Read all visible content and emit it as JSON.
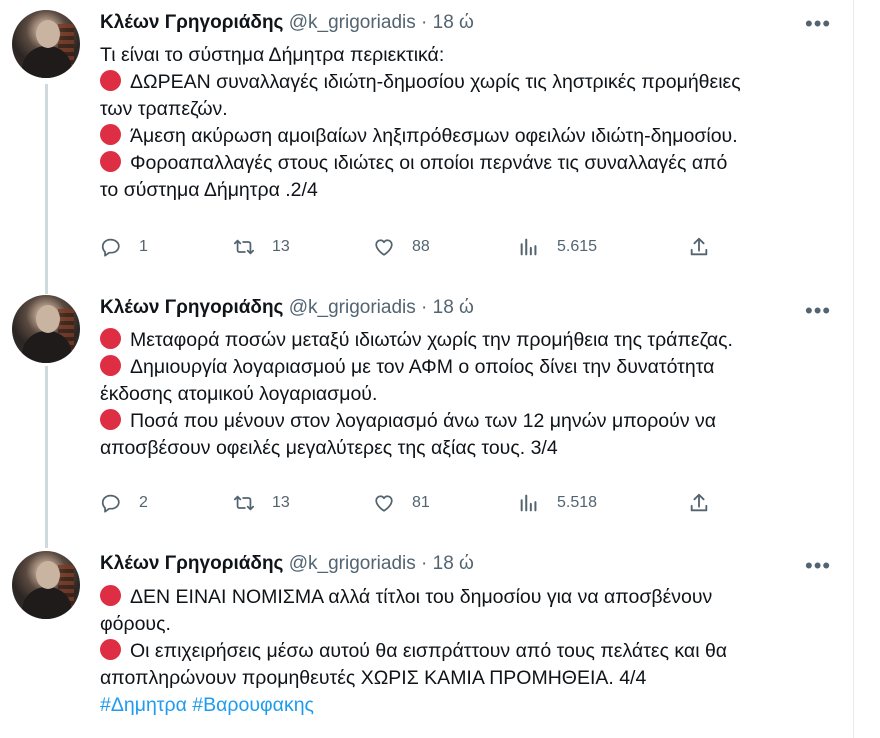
{
  "tweets": [
    {
      "author": {
        "name": "Κλέων Γρηγοριάδης",
        "handle": "@k_grigoriadis",
        "separator": "·",
        "time": "18 ώ"
      },
      "more": "•••",
      "lines": [
        {
          "dot": false,
          "text": "Τι είναι το σύστημα Δήμητρα περιεκτικά:"
        },
        {
          "dot": true,
          "text": "ΔΩΡΕΑΝ συναλλαγές ιδιώτη-δημοσίου χωρίς τις ληστρικές προμήθειες"
        },
        {
          "dot": false,
          "text": "των τραπεζών."
        },
        {
          "dot": true,
          "text": "Άμεση ακύρωση αμοιβαίων ληξιπρόθεσμων οφειλών ιδιώτη-δημοσίου."
        },
        {
          "dot": true,
          "text": "Φοροαπαλλαγές στους ιδιώτες οι οποίοι περνάνε τις συναλλαγές από"
        },
        {
          "dot": false,
          "text": "το σύστημα Δήμητρα .2/4"
        }
      ],
      "stats": {
        "replies": "1",
        "retweets": "13",
        "likes": "88",
        "views": "5.615"
      }
    },
    {
      "author": {
        "name": "Κλέων Γρηγοριάδης",
        "handle": "@k_grigoriadis",
        "separator": "·",
        "time": "18 ώ"
      },
      "more": "•••",
      "lines": [
        {
          "dot": true,
          "text": "Μεταφορά ποσών μεταξύ ιδιωτών χωρίς την προμήθεια της τράπεζας."
        },
        {
          "dot": true,
          "text": "Δημιουργία λογαριασμού με τον ΑΦΜ ο οποίος δίνει την δυνατότητα"
        },
        {
          "dot": false,
          "text": "έκδοσης ατομικού λογαριασμού."
        },
        {
          "dot": true,
          "text": "Ποσά που μένουν στον λογαριασμό άνω των 12 μηνών μπορούν να"
        },
        {
          "dot": false,
          "text": "αποσβέσουν οφειλές μεγαλύτερες της αξίας τους. 3/4"
        }
      ],
      "stats": {
        "replies": "2",
        "retweets": "13",
        "likes": "81",
        "views": "5.518"
      }
    },
    {
      "author": {
        "name": "Κλέων Γρηγοριάδης",
        "handle": "@k_grigoriadis",
        "separator": "·",
        "time": "18 ώ"
      },
      "more": "•••",
      "lines": [
        {
          "dot": true,
          "text": "ΔΕΝ ΕΙΝΑΙ ΝΟΜΙΣΜΑ αλλά τίτλοι του δημοσίου για να αποσβένουν"
        },
        {
          "dot": false,
          "text": "φόρους."
        },
        {
          "dot": true,
          "text": "Οι επιχειρήσεις μέσω αυτού θα εισπράττουν από τους πελάτες και θα"
        },
        {
          "dot": false,
          "text": "αποπληρώνουν προμηθευτές ΧΩΡΙΣ ΚΑΜΙΑ ΠΡΟΜΗΘΕΙΑ. 4/4"
        }
      ],
      "hashtags": [
        "#Δημητρα",
        "#Βαρουφακης"
      ]
    }
  ],
  "colors": {
    "emoji_red_circle": "#dd2e44",
    "hashtag": "#1d9bf0",
    "secondary_text": "#536471",
    "thread_line": "#cfd9de"
  },
  "icons": {
    "reply": "reply-icon",
    "retweet": "retweet-icon",
    "like": "like-icon",
    "views": "views-icon",
    "share": "share-icon",
    "more": "more-options-icon",
    "emoji": "red-circle-emoji-icon"
  }
}
